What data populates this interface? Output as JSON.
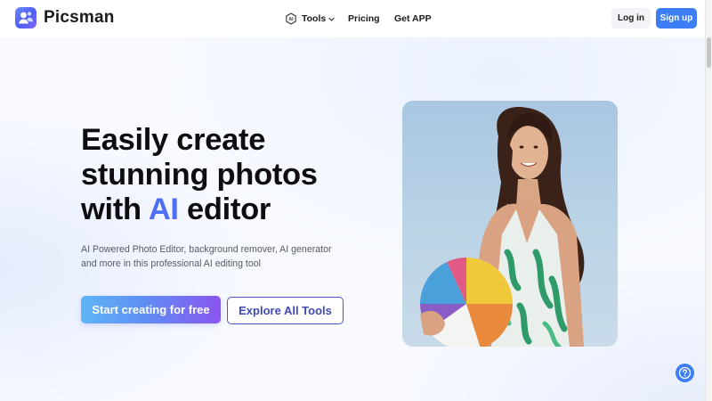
{
  "header": {
    "brand": "Picsman",
    "nav": {
      "tools_label": "Tools",
      "pricing_label": "Pricing",
      "get_app_label": "Get APP"
    },
    "login_label": "Log in",
    "signup_label": "Sign up"
  },
  "hero": {
    "headline_line1": "Easily create",
    "headline_line2": "stunning photos",
    "headline_line3_pre": "with",
    "headline_line3_ai": "AI",
    "headline_line3_post": "editor",
    "subtext": "AI Powered Photo Editor, background remover, AI generator and more in this professional AI editing tool",
    "cta_primary": "Start creating for free",
    "cta_secondary": "Explore All Tools"
  },
  "colors": {
    "accent_blue": "#3d7df5",
    "ai_highlight": "#4f6ff3",
    "explore_border": "#4b58c9"
  },
  "icons": {
    "logo": "picsman-logo-icon",
    "tools": "ai-chip-icon",
    "tools_dropdown": "chevron-down-icon",
    "help": "question-circle-icon"
  }
}
